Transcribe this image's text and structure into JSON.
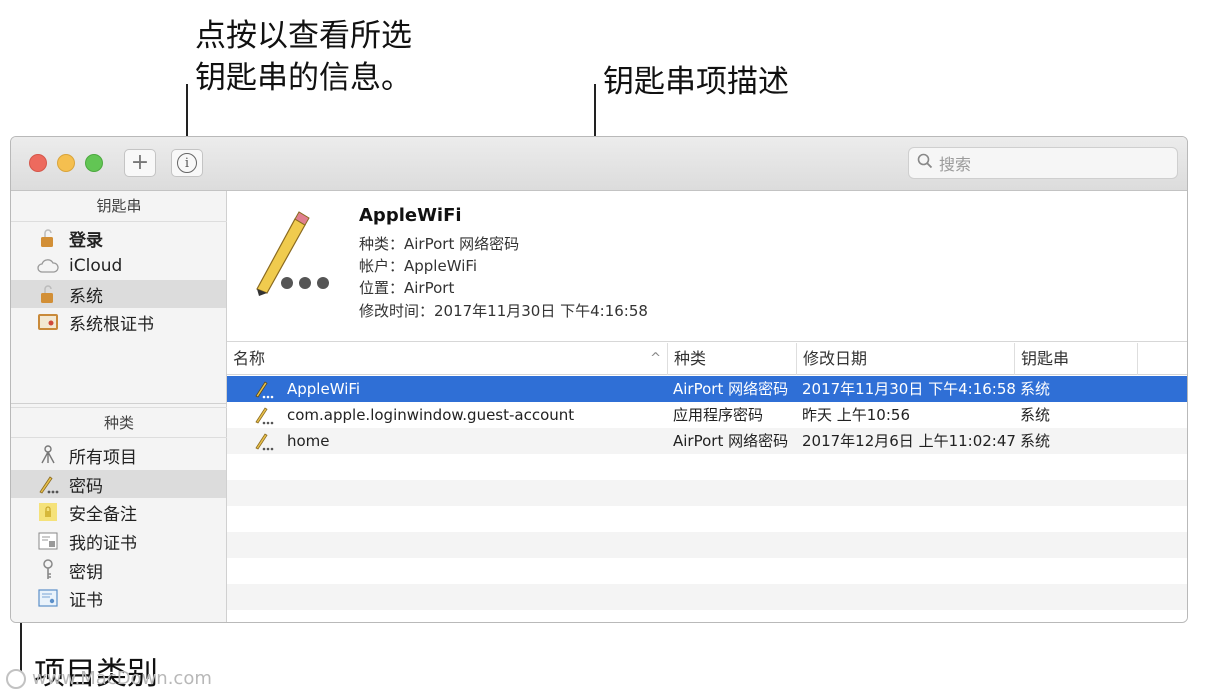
{
  "callouts": {
    "info_line1": "点按以查看所选",
    "info_line2": "钥匙串的信息。",
    "description": "钥匙串项描述",
    "category": "项目类别"
  },
  "toolbar": {
    "add_label": "+",
    "info_label": "i",
    "search_placeholder": "搜索",
    "traffic_lights": {
      "close": "#ed6a5e",
      "minimize": "#f5bf4f",
      "zoom": "#62c554"
    }
  },
  "sidebar": {
    "keychains_header": "钥匙串",
    "keychains": [
      {
        "label": "登录",
        "icon": "lock-icon",
        "bold": true,
        "selected": false
      },
      {
        "label": "iCloud",
        "icon": "cloud-icon",
        "bold": false,
        "selected": false
      },
      {
        "label": "系统",
        "icon": "lock-icon",
        "bold": false,
        "selected": true
      },
      {
        "label": "系统根证书",
        "icon": "certificate-cabinet-icon",
        "bold": false,
        "selected": false
      }
    ],
    "categories_header": "种类",
    "categories": [
      {
        "label": "所有项目",
        "icon": "all-items-icon",
        "selected": false
      },
      {
        "label": "密码",
        "icon": "pencil-icon",
        "selected": true
      },
      {
        "label": "安全备注",
        "icon": "secure-note-icon",
        "selected": false
      },
      {
        "label": "我的证书",
        "icon": "my-certificate-icon",
        "selected": false
      },
      {
        "label": "密钥",
        "icon": "key-icon",
        "selected": false
      },
      {
        "label": "证书",
        "icon": "certificate-icon",
        "selected": false
      }
    ]
  },
  "detail": {
    "name": "AppleWiFi",
    "kind": "种类：AirPort 网络密码",
    "account": "帐户：AppleWiFi",
    "where": "位置：AirPort",
    "modified": "修改时间：2017年11月30日 下午4:16:58"
  },
  "table": {
    "columns": [
      "名称",
      "种类",
      "修改日期",
      "钥匙串"
    ],
    "sort_indicator": "^",
    "rows": [
      {
        "name": "AppleWiFi",
        "kind": "AirPort 网络密码",
        "date": "2017年11月30日 下午4:16:58",
        "keychain": "系统",
        "selected": true
      },
      {
        "name": "com.apple.loginwindow.guest-account",
        "kind": "应用程序密码",
        "date": "昨天 上午10:56",
        "keychain": "系统",
        "selected": false
      },
      {
        "name": "home",
        "kind": "AirPort 网络密码",
        "date": "2017年12月6日 上午11:02:47",
        "keychain": "系统",
        "selected": false
      }
    ],
    "selection_color": "#2f6fd6"
  },
  "watermark": "www.MacDown.com"
}
